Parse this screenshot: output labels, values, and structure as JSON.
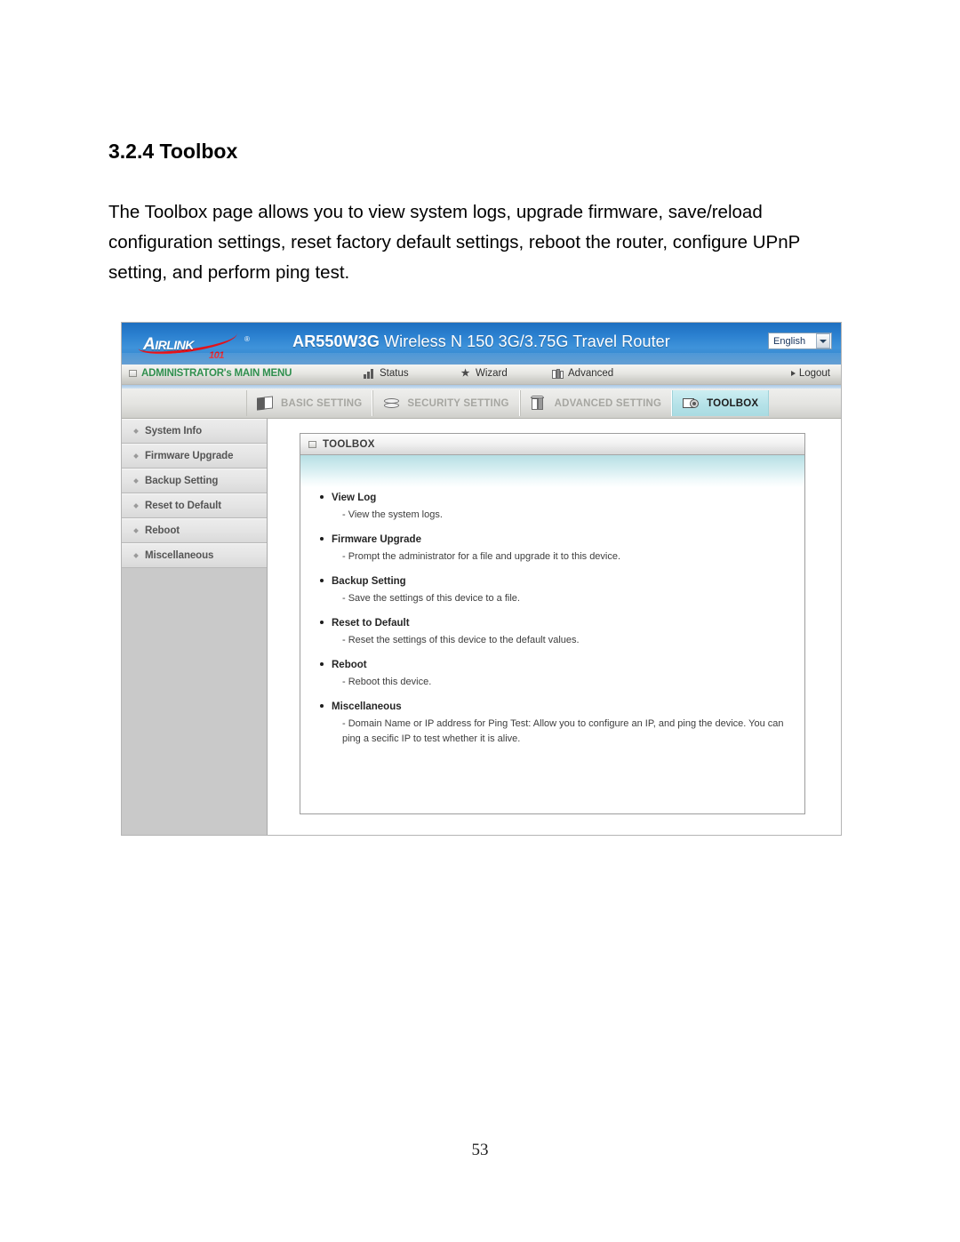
{
  "document": {
    "heading": "3.2.4 Toolbox",
    "body": "The Toolbox page allows you to view system logs, upgrade firmware, save/reload configuration settings, reset factory default settings, reboot the router, configure UPnP setting, and perform ping test.",
    "page_number": "53"
  },
  "router_ui": {
    "brand": {
      "name_a": "A",
      "name_rest": "IRLINK",
      "registered": "®",
      "sub": "101"
    },
    "product_title_model": "AR550W3G",
    "product_title_rest": " Wireless N 150 3G/3.75G Travel Router",
    "language": {
      "selected": "English",
      "options": [
        "English"
      ]
    },
    "menu": {
      "main_menu": "ADMINISTRATOR's MAIN MENU",
      "items": [
        {
          "label": "Status",
          "icon": "signal-bars-icon"
        },
        {
          "label": "Wizard",
          "icon": "wand-icon"
        },
        {
          "label": "Advanced",
          "icon": "books-icon"
        }
      ],
      "logout": "Logout"
    },
    "tabs": [
      {
        "label": "BASIC SETTING",
        "icon": "books-stack-icon",
        "active": false
      },
      {
        "label": "SECURITY SETTING",
        "icon": "shield-stack-icon",
        "active": false
      },
      {
        "label": "ADVANCED SETTING",
        "icon": "book-row-icon",
        "active": false
      },
      {
        "label": "TOOLBOX",
        "icon": "toolbox-gear-icon",
        "active": true
      }
    ],
    "sidebar": {
      "items": [
        {
          "label": "System Info"
        },
        {
          "label": "Firmware Upgrade"
        },
        {
          "label": "Backup Setting"
        },
        {
          "label": "Reset to Default"
        },
        {
          "label": "Reboot"
        },
        {
          "label": "Miscellaneous"
        }
      ]
    },
    "panel": {
      "title": "TOOLBOX",
      "items": [
        {
          "title": "View Log",
          "desc": "- View the system logs."
        },
        {
          "title": "Firmware Upgrade",
          "desc": "- Prompt the administrator for a file and upgrade it to this device."
        },
        {
          "title": "Backup Setting",
          "desc": "- Save the settings of this device to a file."
        },
        {
          "title": "Reset to Default",
          "desc": "- Reset the settings of this device to the default values."
        },
        {
          "title": "Reboot",
          "desc": "- Reboot this device."
        },
        {
          "title": "Miscellaneous",
          "desc": "- Domain Name or IP address for Ping Test: Allow you to configure an IP, and ping the device. You can ping a secific IP to test whether it is alive."
        }
      ]
    },
    "colors": {
      "header_blue": "#2a7fcf",
      "accent_red": "#e2121a",
      "menu_green": "#2f8f4e",
      "active_tab_cyan": "#b6e2e8",
      "sidebar_grey": "#c9c9c9"
    }
  }
}
